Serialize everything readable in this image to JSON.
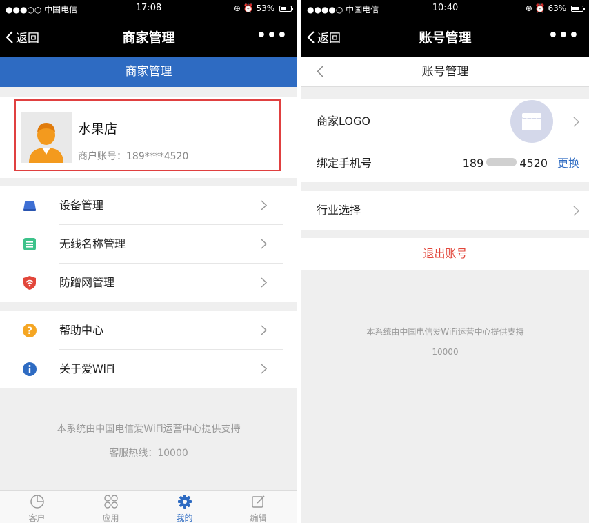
{
  "left": {
    "status": {
      "carrier": "●●●○○ 中国电信",
      "time": "17:08",
      "battery": "53%",
      "battery_level": 0.53
    },
    "nav": {
      "back_label": "返回",
      "title": "商家管理",
      "more": "•••"
    },
    "subheader": "商家管理",
    "profile": {
      "name": "水果店",
      "account_label": "商户账号：",
      "account_value": "189****4520"
    },
    "menu_group_1": [
      {
        "label": "设备管理",
        "icon": "device-icon",
        "color": "#3e6fd4"
      },
      {
        "label": "无线名称管理",
        "icon": "wifi-name-icon",
        "color": "#3cc28a"
      },
      {
        "label": "防蹭网管理",
        "icon": "shield-wifi-icon",
        "color": "#e2463a"
      }
    ],
    "menu_group_2": [
      {
        "label": "帮助中心",
        "icon": "help-icon",
        "color": "#f5a623"
      },
      {
        "label": "关于爱WiFi",
        "icon": "info-icon",
        "color": "#2e6bc2"
      }
    ],
    "footer": {
      "line1": "本系统由中国电信爱WiFi运营中心提供支持",
      "line2": "客服热线：10000"
    },
    "tabs": [
      {
        "label": "客户",
        "icon": "pie-chart-icon",
        "active": false
      },
      {
        "label": "应用",
        "icon": "apps-icon",
        "active": false
      },
      {
        "label": "我的",
        "icon": "gear-icon",
        "active": true
      },
      {
        "label": "编辑",
        "icon": "edit-icon",
        "active": false
      }
    ]
  },
  "right": {
    "status": {
      "carrier": "●●●●○ 中国电信",
      "time": "10:40",
      "battery": "63%",
      "battery_level": 0.63
    },
    "nav": {
      "back_label": "返回",
      "title": "账号管理",
      "more": "•••"
    },
    "subheader": "账号管理",
    "rows": {
      "logo_label": "商家LOGO",
      "phone_label": "绑定手机号",
      "phone_prefix": "189",
      "phone_suffix": "4520",
      "change_label": "更换",
      "industry_label": "行业选择"
    },
    "logout_label": "退出账号",
    "footer": {
      "line1": "本系统由中国电信爱WiFi运营中心提供支持",
      "line2": "10000"
    }
  },
  "colors": {
    "accent": "#2e6bc2",
    "danger": "#e2463a",
    "highlight_border": "#e04040",
    "avatar_orange": "#f39a1e"
  }
}
